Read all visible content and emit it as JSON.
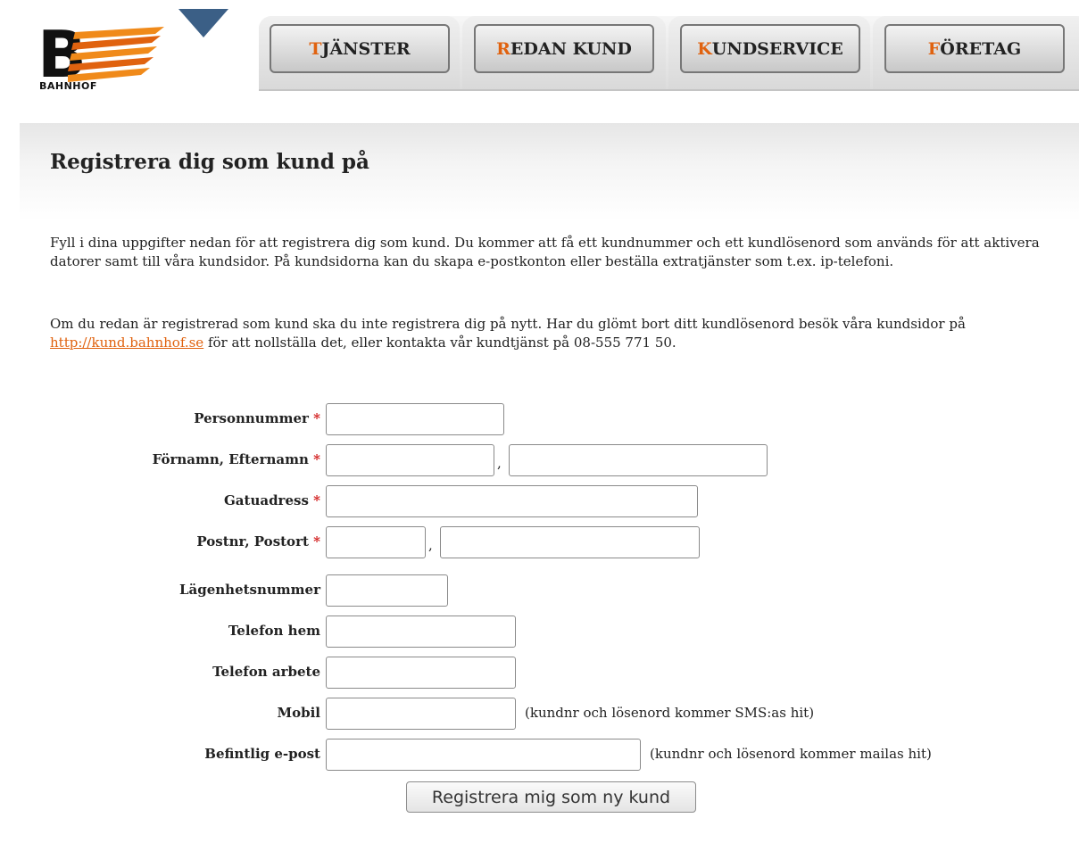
{
  "brand": {
    "name": "BAHNHOF",
    "accent_color": "#e0620f",
    "logo_icon": "bahnhof-logo"
  },
  "nav": {
    "tabs": [
      {
        "first": "T",
        "rest": "JÄNSTER"
      },
      {
        "first": "R",
        "rest": "EDAN KUND"
      },
      {
        "first": "K",
        "rest": "UNDSERVICE"
      },
      {
        "first": "F",
        "rest": "ÖRETAG"
      }
    ]
  },
  "page": {
    "title": "Registrera dig som kund på",
    "intro": "Fyll i dina uppgifter nedan för att registrera dig som kund. Du kommer att få ett kundnummer och ett kundlösenord som används för att aktivera datorer samt till våra kundsidor. På kundsidorna kan du skapa e-postkonton eller beställa extratjänster som t.ex. ip-telefoni.",
    "existing_before": "Om du redan är registrerad som kund ska du inte registrera dig på nytt. Har du glömt bort ditt kundlösenord besök våra kundsidor på ",
    "existing_link": "http://kund.bahnhof.se",
    "existing_after": " för att nollställa det, eller kontakta vår kundtjänst på 08-555 771 50."
  },
  "form": {
    "required_mark": "*",
    "separator": ",",
    "personnummer": {
      "label": "Personnummer",
      "value": ""
    },
    "name": {
      "label": "Förnamn, Efternamn",
      "first_value": "",
      "last_value": ""
    },
    "street": {
      "label": "Gatuadress",
      "value": ""
    },
    "postal": {
      "label": "Postnr, Postort",
      "zip_value": "",
      "city_value": ""
    },
    "apartment": {
      "label": "Lägenhetsnummer",
      "value": ""
    },
    "phone_home": {
      "label": "Telefon hem",
      "value": ""
    },
    "phone_work": {
      "label": "Telefon arbete",
      "value": ""
    },
    "mobile": {
      "label": "Mobil",
      "value": "",
      "hint": "(kundnr och lösenord kommer SMS:as hit)"
    },
    "email": {
      "label": "Befintlig e-post",
      "value": "",
      "hint": "(kundnr och lösenord kommer mailas hit)"
    },
    "submit_label": "Registrera mig som ny kund"
  }
}
